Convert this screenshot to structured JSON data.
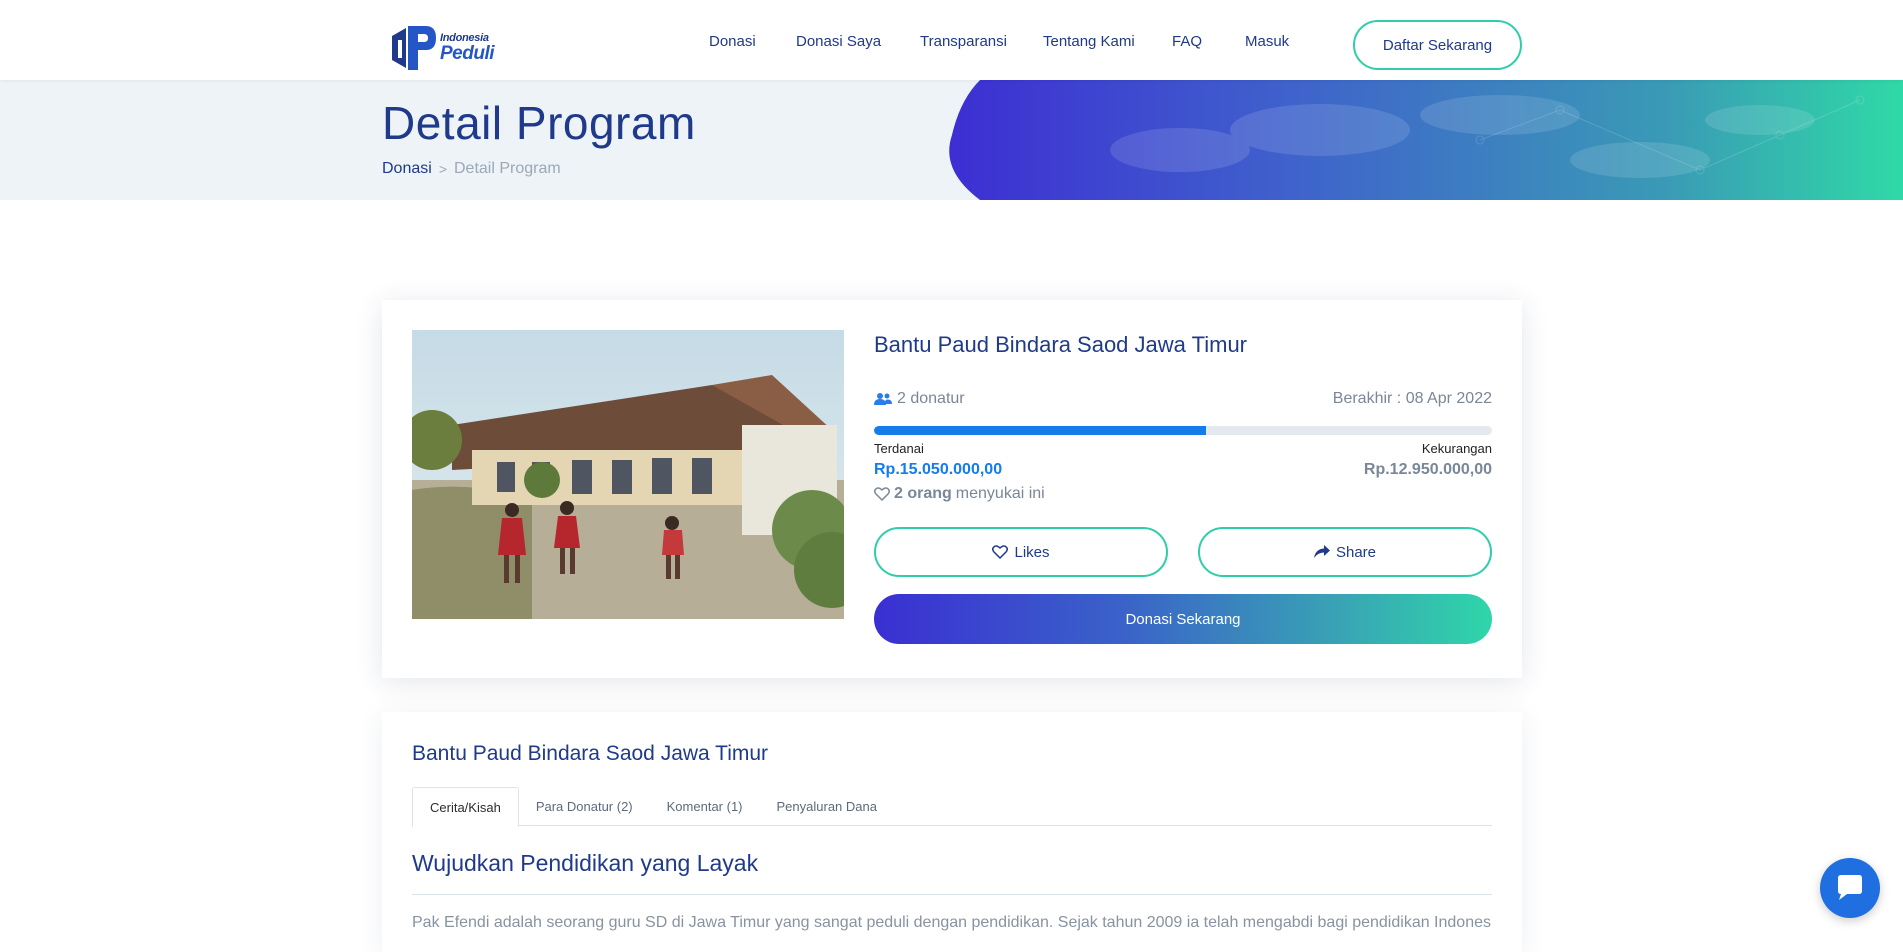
{
  "header": {
    "logo": {
      "line1": "Indonesia",
      "line2": "Peduli"
    },
    "nav": [
      {
        "label": "Donasi"
      },
      {
        "label": "Donasi Saya"
      },
      {
        "label": "Transparansi"
      },
      {
        "label": "Tentang Kami"
      },
      {
        "label": "FAQ"
      },
      {
        "label": "Masuk"
      }
    ],
    "cta_label": "Daftar Sekarang"
  },
  "banner": {
    "title": "Detail Program",
    "breadcrumb": {
      "parent": "Donasi",
      "separator": ">",
      "current": "Detail Program"
    }
  },
  "program": {
    "title": "Bantu Paud Bindara Saod Jawa Timur",
    "donors": "2 donatur",
    "deadline": "Berakhir : 08 Apr 2022",
    "progress_percent": 53.75,
    "raised_label": "Terdanai",
    "raised_amount": "Rp.15.050.000,00",
    "remaining_label": "Kekurangan",
    "remaining_amount": "Rp.12.950.000,00",
    "likes_count": "2 orang",
    "likes_text": "menyukai ini",
    "likes_button": "Likes",
    "share_button": "Share",
    "donate_button": "Donasi Sekarang"
  },
  "detail": {
    "title": "Bantu Paud Bindara Saod Jawa Timur",
    "tabs": [
      {
        "label": "Cerita/Kisah"
      },
      {
        "label": "Para Donatur (2)"
      },
      {
        "label": "Komentar (1)"
      },
      {
        "label": "Penyaluran Dana"
      }
    ],
    "active_tab": 0,
    "heading": "Wujudkan Pendidikan yang Layak",
    "paragraph": "Pak Efendi adalah seorang guru SD di Jawa Timur yang sangat peduli dengan pendidikan. Sejak tahun 2009 ia telah mengabdi bagi pendidikan Indonesia,"
  },
  "colors": {
    "brand_navy": "#1f3a8a",
    "accent_teal": "#2fcda9",
    "progress_blue": "#157ce8",
    "chat_blue": "#1f6fe0"
  },
  "icons": [
    "users-icon",
    "heart-icon",
    "share-icon",
    "chat-icon"
  ]
}
